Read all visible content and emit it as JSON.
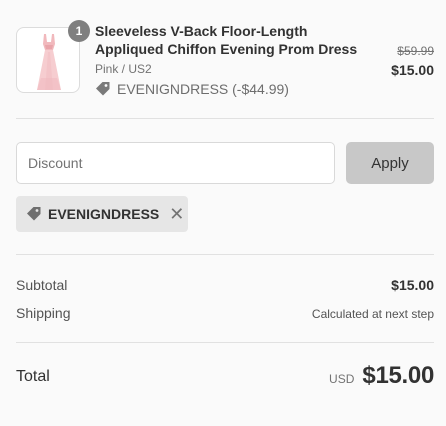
{
  "product": {
    "quantity": "1",
    "name": "Sleeveless V-Back Floor-Length Appliqued Chiffon Evening Prom Dress",
    "variant": "Pink / US2",
    "discount_text": "EVENIGNDRESS (-$44.99)",
    "original_price": "$59.99",
    "final_price": "$15.00",
    "thumbnail_icon": "dress-thumbnail"
  },
  "discount_form": {
    "placeholder": "Discount",
    "value": "",
    "apply_label": "Apply"
  },
  "applied_code": {
    "label": "EVENIGNDRESS",
    "icon": "tag-icon",
    "remove_icon": "close-icon"
  },
  "summary": {
    "subtotal_label": "Subtotal",
    "subtotal_value": "$15.00",
    "shipping_label": "Shipping",
    "shipping_value": "Calculated at next step",
    "total_label": "Total",
    "currency": "USD",
    "total_value": "$15.00"
  },
  "colors": {
    "background": "#fafafa",
    "apply_button": "#c8c8c8",
    "tag_background": "#e6e6e6",
    "quantity_badge": "#7f7f7f",
    "dress": "#f4c6c8"
  }
}
